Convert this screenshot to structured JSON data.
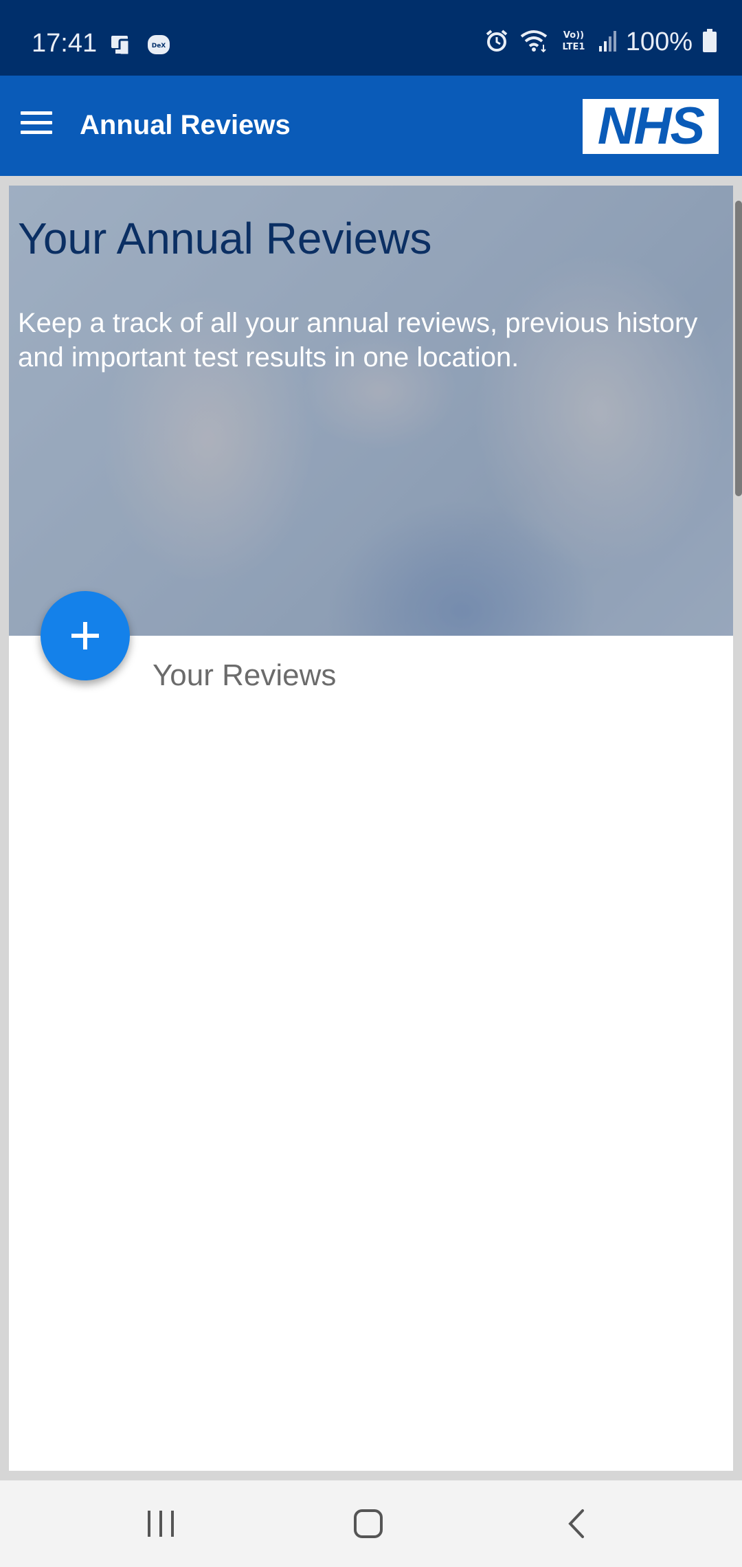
{
  "status_bar": {
    "time": "17:41",
    "battery": "100%",
    "left_icons": [
      "screen-mirror-icon",
      "dex-icon"
    ],
    "right_icons": [
      "alarm-icon",
      "wifi-icon",
      "volte-icon",
      "signal-icon",
      "battery-icon"
    ],
    "volte_label_top": "Vo))",
    "volte_label_bottom": "LTE1",
    "dex_label": "DeX"
  },
  "app_bar": {
    "title": "Annual Reviews",
    "logo_text": "NHS"
  },
  "hero": {
    "title": "Your Annual Reviews",
    "description": "Keep a track of all your annual reviews, previous history and important test results in one location."
  },
  "reviews": {
    "section_title": "Your Reviews",
    "add_button_symbol": "+"
  },
  "colors": {
    "status_bar": "#002f6b",
    "app_bar": "#0a5bb8",
    "fab": "#1481ea",
    "hero_title": "#0b2f63"
  }
}
